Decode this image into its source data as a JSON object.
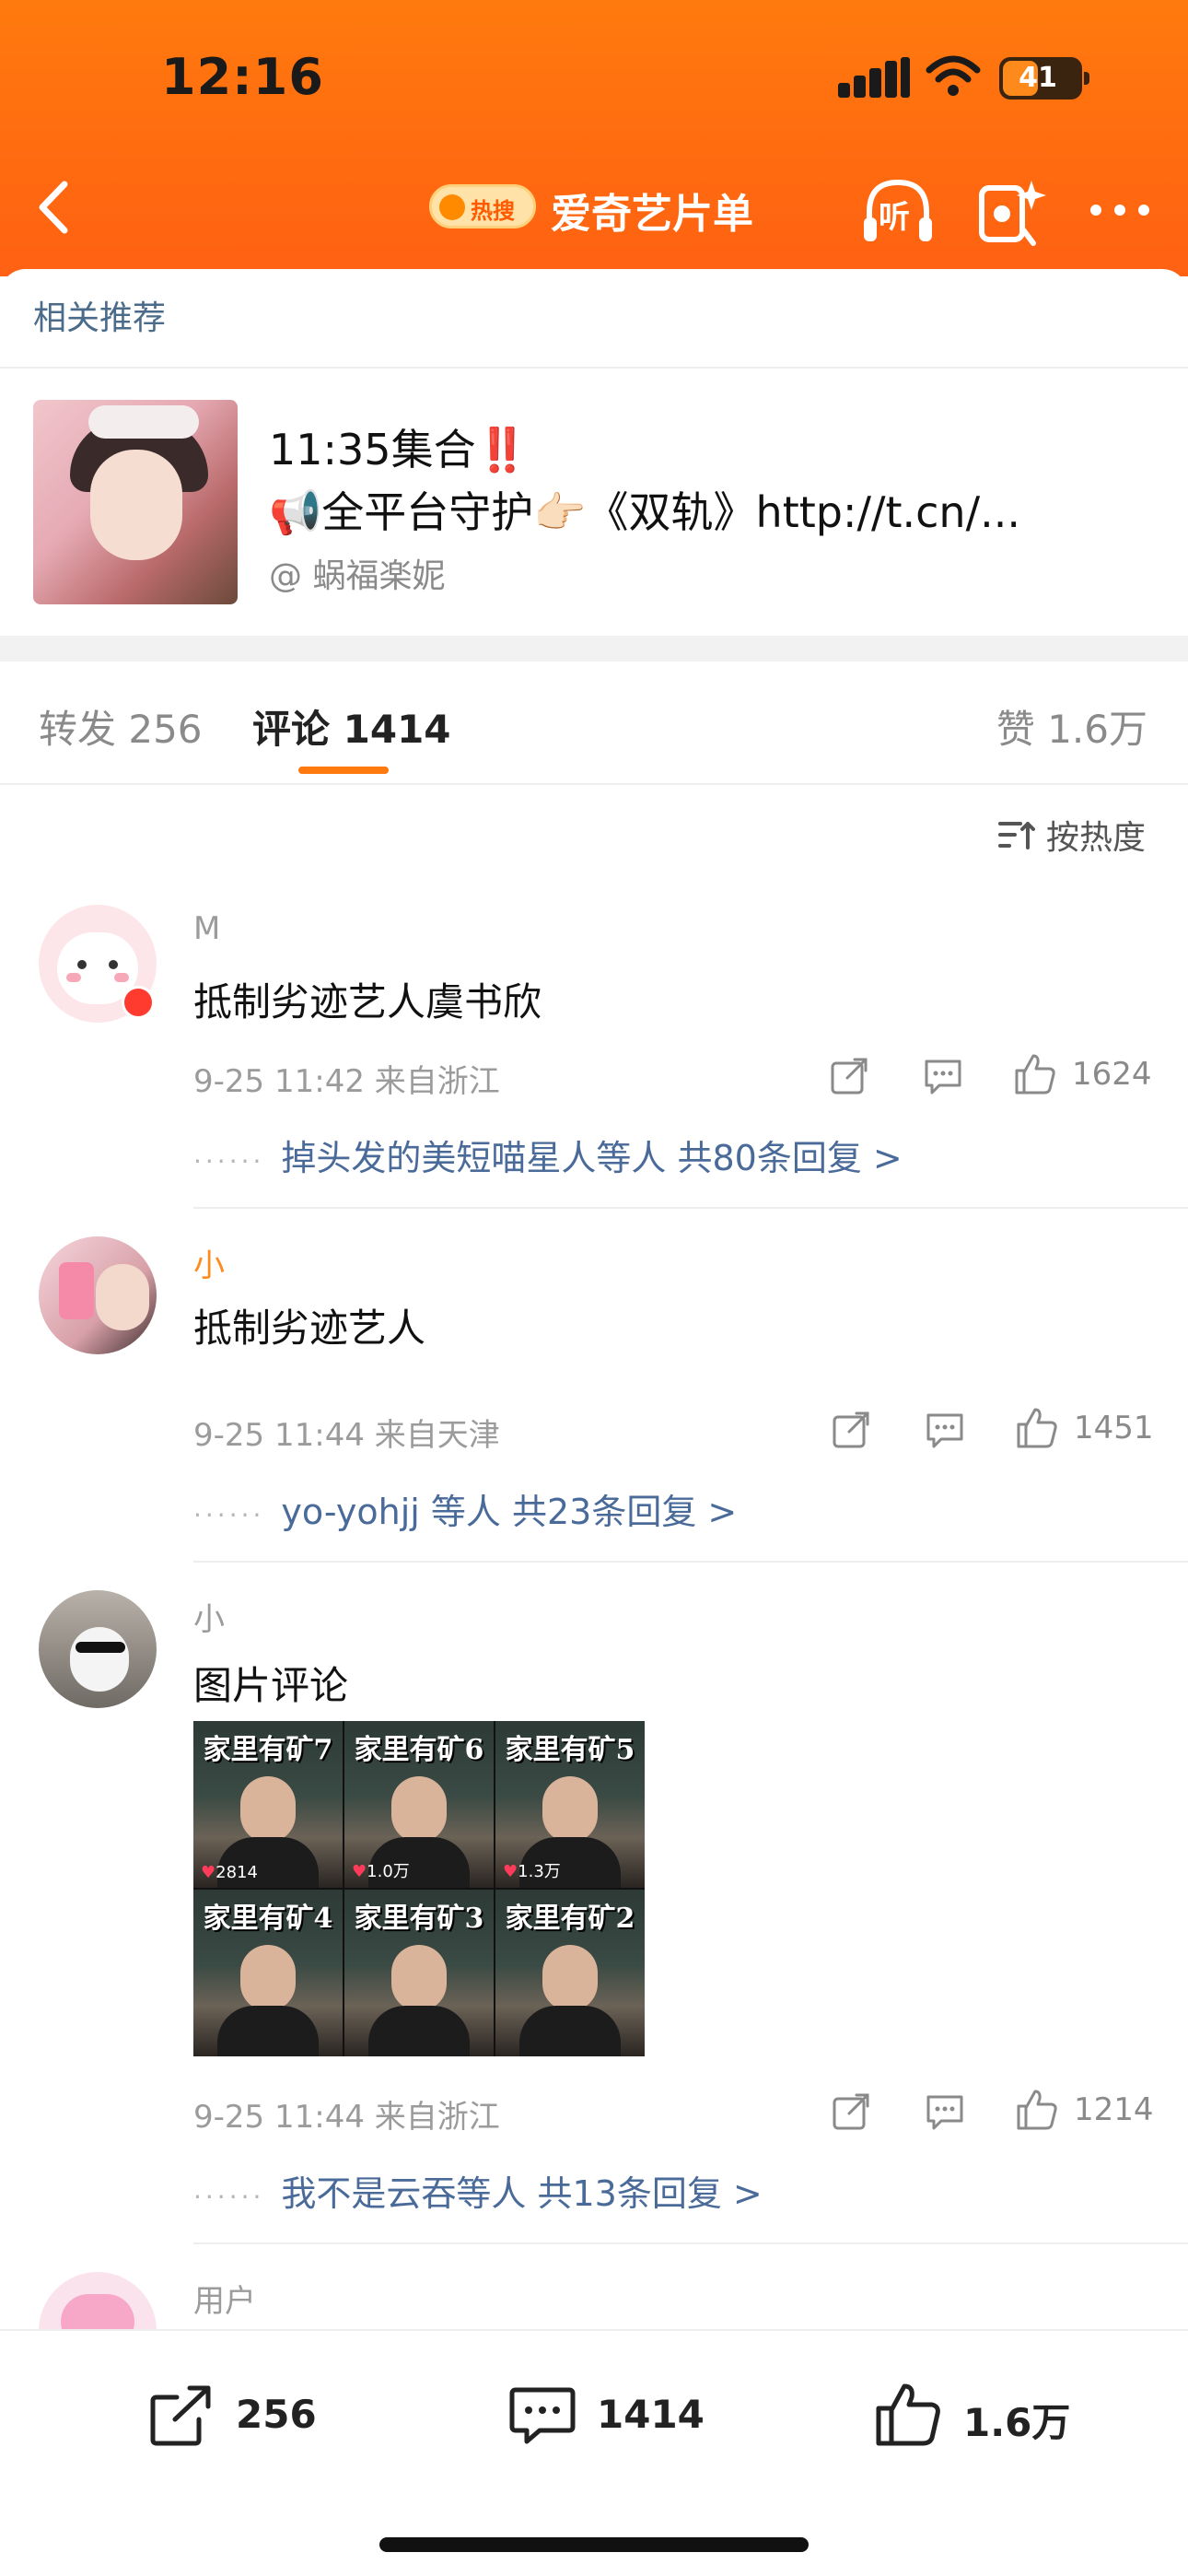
{
  "status_bar": {
    "time": "12:16",
    "battery": "41"
  },
  "header": {
    "hot_badge": "热搜",
    "title": "爱奇艺片单",
    "listen_label": "听"
  },
  "related": {
    "label": "相关推荐"
  },
  "post": {
    "line1": "11:35集合",
    "line1_emoji": "‼️",
    "line2": "📢全平台守护👉🏻《双轨》http://t.cn/...",
    "author": "@ 蜗福楽妮"
  },
  "tabs": {
    "repost": "转发 256",
    "comment": "评论 1414",
    "like": "赞 1.6万"
  },
  "sort": {
    "label": "按热度"
  },
  "comments": [
    {
      "username": "M",
      "text": "抵制劣迹艺人虞书欣",
      "meta": "9-25 11:42 来自浙江",
      "likes": "1624",
      "replies": "掉头发的美短喵星人等人 共80条回复 >"
    },
    {
      "username": "小",
      "text": "抵制劣迹艺人",
      "meta": "9-25 11:44 来自天津",
      "likes": "1451",
      "replies": "yo-yohjj 等人 共23条回复 >"
    },
    {
      "username": "小",
      "text": "图片评论",
      "meta": "9-25 11:44 来自浙江",
      "likes": "1214",
      "replies": "我不是云吞等人 共13条回复 >",
      "images": [
        {
          "caption": "家里有矿7",
          "likes": "2814"
        },
        {
          "caption": "家里有矿6",
          "likes": "1.0万"
        },
        {
          "caption": "家里有矿5",
          "likes": "1.3万"
        },
        {
          "caption": "家里有矿4",
          "likes": ""
        },
        {
          "caption": "家里有矿3",
          "likes": ""
        },
        {
          "caption": "家里有矿2",
          "likes": ""
        }
      ]
    },
    {
      "username": "用户"
    }
  ],
  "bottom_bar": {
    "repost": "256",
    "comment": "1414",
    "like": "1.6万"
  },
  "colors": {
    "brand": "#ff7a0e",
    "link": "#4a6b9a",
    "meta": "#9b9b9b"
  },
  "icons": [
    "back-icon",
    "hot-search-icon",
    "listen-icon",
    "red-packet-icon",
    "more-icon",
    "sort-icon",
    "share-icon",
    "reply-icon",
    "like-icon"
  ]
}
